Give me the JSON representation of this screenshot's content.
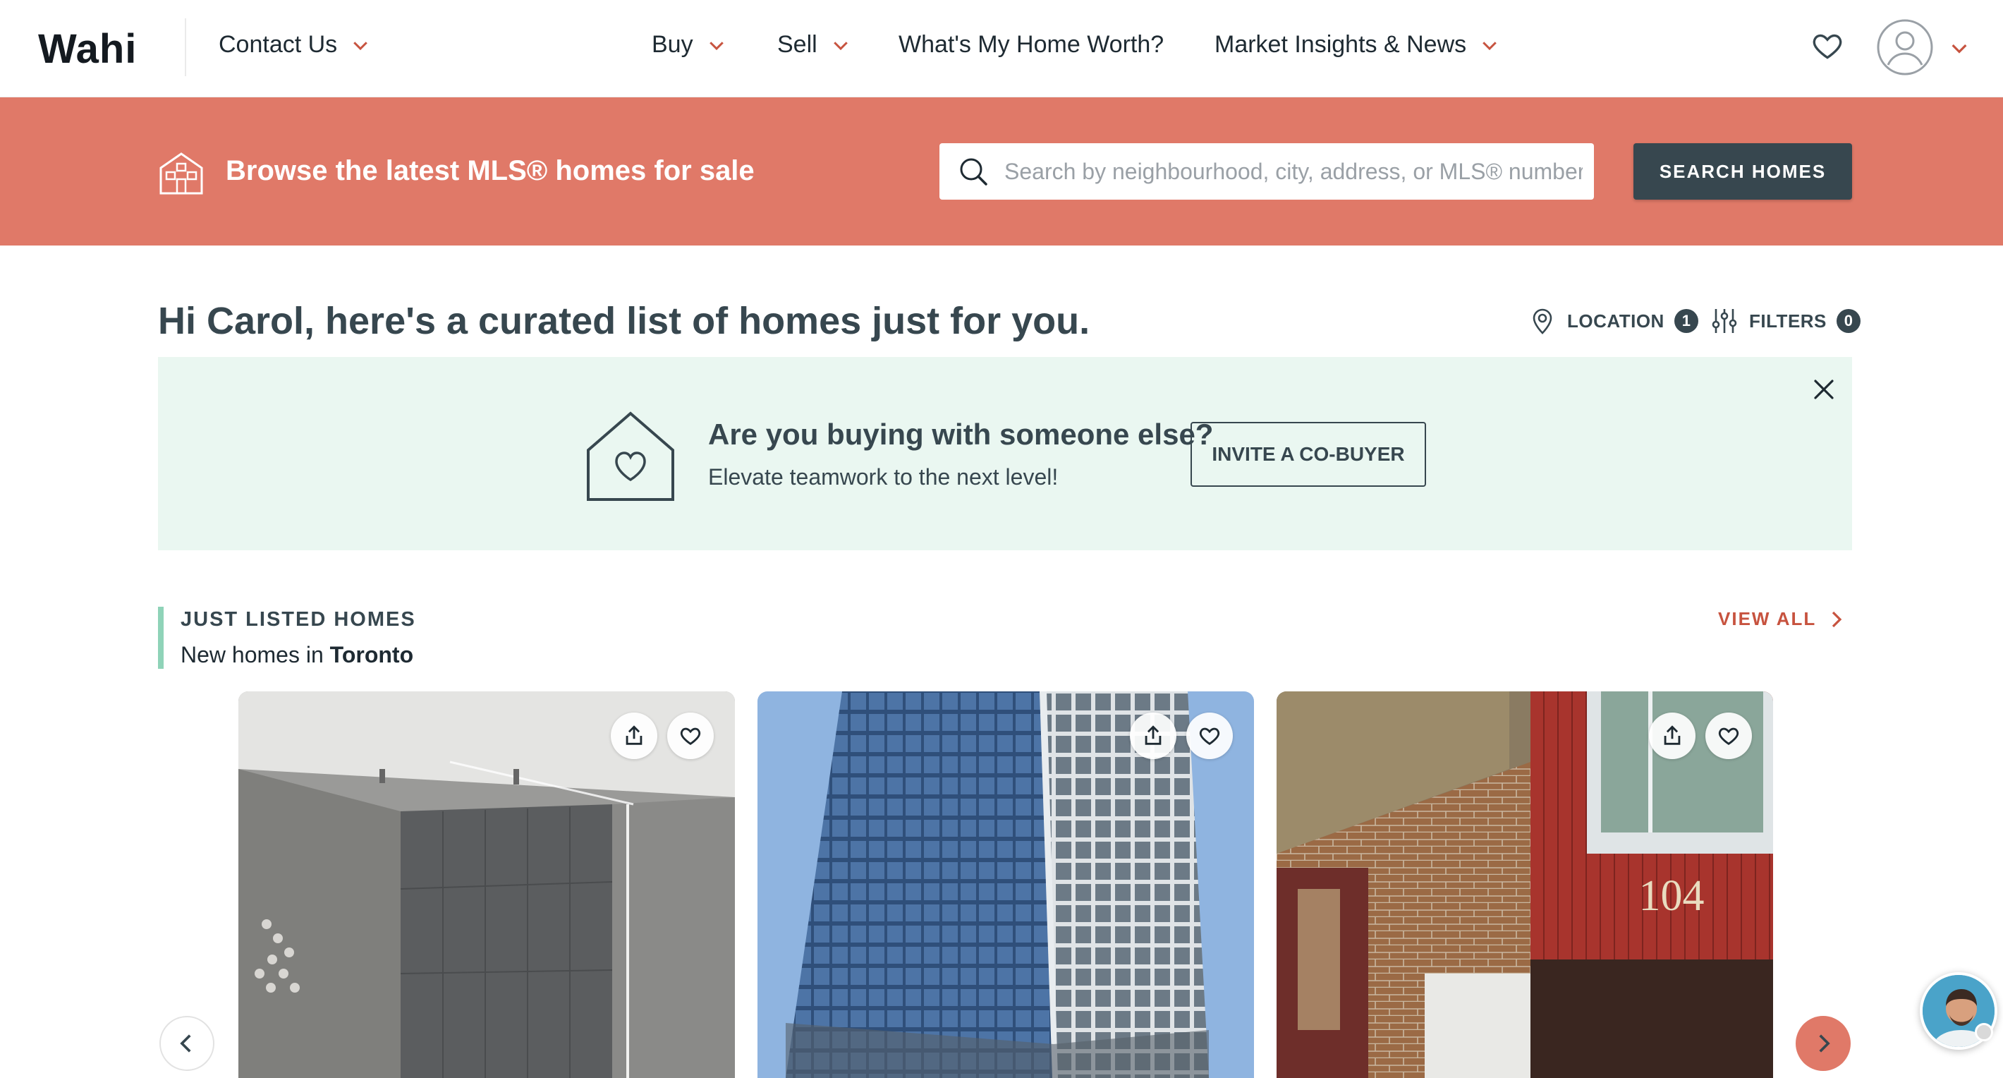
{
  "header": {
    "logo": "Wahi",
    "nav": [
      {
        "label": "Contact Us",
        "has_dropdown": true
      },
      {
        "label": "Buy",
        "has_dropdown": true
      },
      {
        "label": "Sell",
        "has_dropdown": true
      },
      {
        "label": "What's My Home Worth?",
        "has_dropdown": false
      },
      {
        "label": "Market Insights & News",
        "has_dropdown": true
      }
    ],
    "icons": [
      "heart-icon",
      "user-avatar-icon",
      "chevron-down-icon"
    ]
  },
  "banner": {
    "title": "Browse the latest MLS® homes for sale",
    "search_placeholder": "Search by neighbourhood, city, address, or MLS® number",
    "search_button": "SEARCH HOMES",
    "background": "#e07968"
  },
  "greeting": {
    "text": "Hi Carol, here's a curated list of homes just for you.",
    "location_label": "LOCATION",
    "location_count": "1",
    "filters_label": "FILTERS",
    "filters_count": "0"
  },
  "cobuyer": {
    "title": "Are you buying with someone else?",
    "subtitle": "Elevate teamwork to the next level!",
    "button": "INVITE A CO-BUYER",
    "background": "#eaf7f1"
  },
  "just_listed": {
    "title": "JUST LISTED HOMES",
    "subtitle_prefix": "New homes in",
    "city": "Toronto",
    "view_all": "VIEW ALL",
    "cards": [
      {
        "image": "condo-lobby-interior"
      },
      {
        "image": "glass-highrise-tower"
      },
      {
        "image": "brick-house-104",
        "house_number": "104"
      }
    ]
  },
  "colors": {
    "accent": "#e07968",
    "dark": "#37474f",
    "mint": "#8fd3b8",
    "link": "#c7533f"
  }
}
